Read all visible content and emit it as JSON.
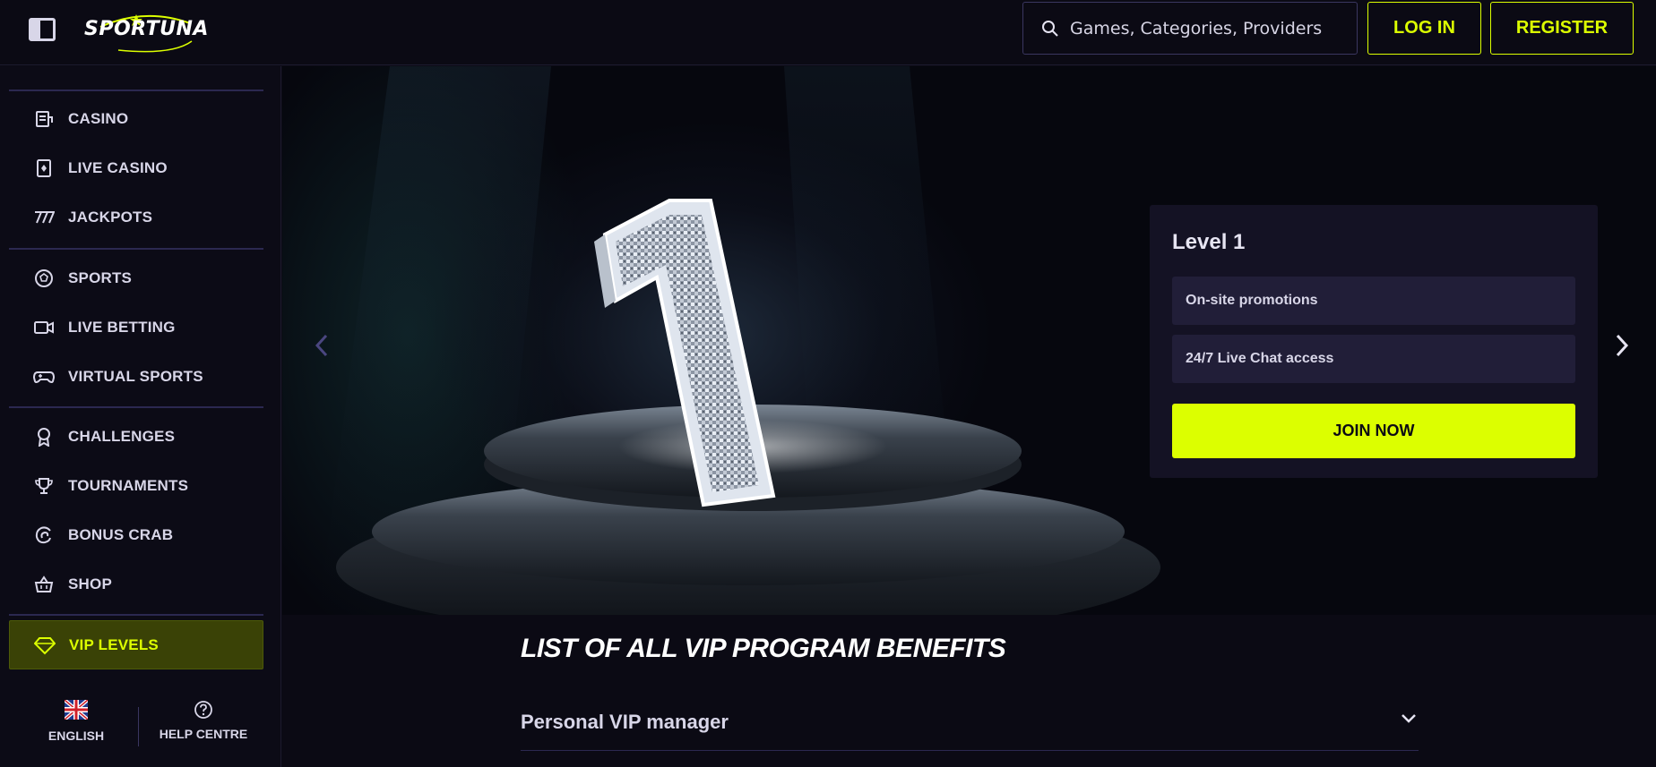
{
  "header": {
    "logo_text": "SPORTUNA",
    "search_placeholder": "Games, Categories, Providers",
    "login_label": "LOG IN",
    "register_label": "REGISTER"
  },
  "sidebar": {
    "items": [
      {
        "label": "CASINO",
        "icon": "casino-icon"
      },
      {
        "label": "LIVE CASINO",
        "icon": "live-casino-icon"
      },
      {
        "label": "JACKPOTS",
        "icon": "jackpots-icon"
      },
      {
        "label": "SPORTS",
        "icon": "soccer-ball-icon"
      },
      {
        "label": "LIVE BETTING",
        "icon": "video-camera-icon"
      },
      {
        "label": "VIRTUAL SPORTS",
        "icon": "gamepad-icon"
      },
      {
        "label": "CHALLENGES",
        "icon": "award-ribbon-icon"
      },
      {
        "label": "TOURNAMENTS",
        "icon": "trophy-icon"
      },
      {
        "label": "BONUS CRAB",
        "icon": "crab-icon"
      },
      {
        "label": "SHOP",
        "icon": "basket-icon"
      },
      {
        "label": "VIP LEVELS",
        "icon": "diamond-icon"
      }
    ],
    "active_item": "VIP LEVELS",
    "language_label": "ENGLISH",
    "help_label": "HELP CENTRE"
  },
  "hero": {
    "level_title": "Level 1",
    "benefits": [
      "On-site promotions",
      "24/7 Live Chat access"
    ],
    "cta_label": "JOIN NOW"
  },
  "benefits_section": {
    "heading": "LIST OF ALL VIP PROGRAM BENEFITS",
    "items": [
      "Personal VIP manager"
    ]
  },
  "colors": {
    "accent": "#dcff00",
    "background": "#0b0a14",
    "card": "#141224",
    "card_row": "#211e38"
  }
}
